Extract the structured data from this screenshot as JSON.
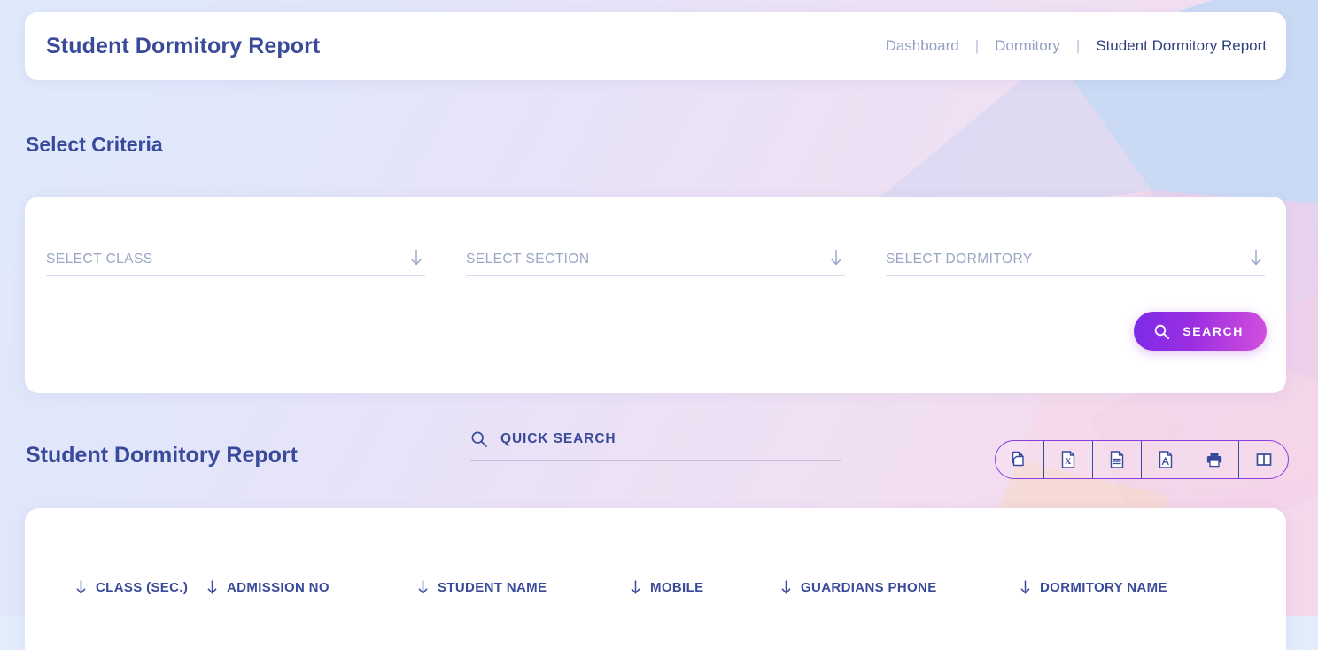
{
  "header": {
    "title": "Student Dormitory Report",
    "breadcrumb": {
      "items": [
        "Dashboard",
        "Dormitory",
        "Student Dormitory Report"
      ],
      "separator": "|"
    }
  },
  "criteria": {
    "heading": "Select Criteria",
    "fields": [
      {
        "label": "SELECT CLASS",
        "icon": "arrow-down-icon",
        "value": ""
      },
      {
        "label": "SELECT SECTION",
        "icon": "arrow-down-icon",
        "value": ""
      },
      {
        "label": "SELECT DORMITORY",
        "icon": "arrow-down-icon",
        "value": ""
      }
    ],
    "search_button": {
      "label": "SEARCH",
      "icon": "search-icon"
    }
  },
  "report": {
    "heading": "Student Dormitory Report",
    "quick_search": {
      "label": "QUICK SEARCH",
      "icon": "search-icon",
      "value": ""
    },
    "export_buttons": [
      {
        "name": "copy-button",
        "icon": "copy-icon"
      },
      {
        "name": "excel-export-button",
        "icon": "excel-file-icon"
      },
      {
        "name": "csv-export-button",
        "icon": "text-file-icon"
      },
      {
        "name": "pdf-export-button",
        "icon": "pdf-file-icon"
      },
      {
        "name": "print-button",
        "icon": "printer-icon"
      },
      {
        "name": "column-visibility-button",
        "icon": "columns-icon"
      }
    ],
    "table": {
      "columns": [
        {
          "label": "CLASS (SEC.)",
          "sort_icon": "sort-arrow-down-icon"
        },
        {
          "label": "ADMISSION NO",
          "sort_icon": "sort-arrow-down-icon"
        },
        {
          "label": "STUDENT NAME",
          "sort_icon": "sort-arrow-down-icon"
        },
        {
          "label": "MOBILE",
          "sort_icon": "sort-arrow-down-icon"
        },
        {
          "label": "GUARDIANS PHONE",
          "sort_icon": "sort-arrow-down-icon"
        },
        {
          "label": "DORMITORY NAME",
          "sort_icon": "sort-arrow-down-icon"
        }
      ],
      "rows": []
    }
  },
  "theme": {
    "primary_text": "#3a4a9a",
    "muted_text": "#9aa4c6",
    "accent_purple": "#8b3de0",
    "gradient_start": "#7c2ae8",
    "gradient_end": "#d34fdd"
  }
}
